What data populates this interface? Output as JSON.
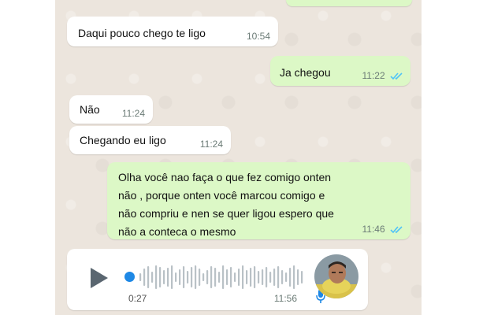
{
  "messages": [
    {
      "direction": "in",
      "text": "Daqui pouco chego te ligo",
      "time": "10:54"
    },
    {
      "direction": "out",
      "text": "Ja chegou",
      "time": "11:22",
      "read": true
    },
    {
      "direction": "in",
      "text": "Não",
      "time": "11:24"
    },
    {
      "direction": "in",
      "text": "Chegando eu ligo",
      "time": "11:24"
    },
    {
      "direction": "out",
      "lines": [
        "Olha você  nao faça  o que fez comigo onten",
        "não   , porque onten você  marcou comigo e",
        "não  compriu e nen se quer ligou espero que",
        "não   a conteca o mesmo"
      ],
      "time": "11:46",
      "read": true
    }
  ],
  "voice": {
    "duration": "0:27",
    "time": "11:56",
    "progress": 0.0
  },
  "colors": {
    "incoming": "#ffffff",
    "outgoing": "#dcf8c6",
    "read_ticks": "#4fc3f7",
    "chat_bg": "#ece5dd",
    "play_dot": "#1e88e5"
  },
  "icons": {
    "read": "double-check-icon",
    "play": "play-icon",
    "mic": "microphone-icon"
  }
}
